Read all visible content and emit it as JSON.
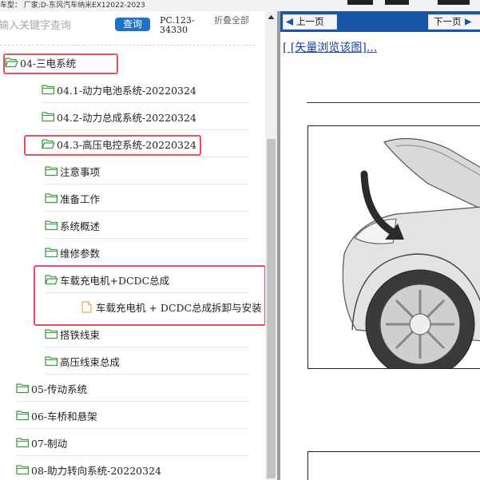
{
  "topbar": {
    "model_text": "车型：  厂家:D-东风汽车纳米EX12022-2023"
  },
  "search": {
    "placeholder": "输入关键字查询",
    "query_label": "查询",
    "code": "PC.123-34330",
    "collapse_label": "折叠全部"
  },
  "tree": {
    "items": [
      {
        "label": "04-三电系统",
        "type": "folder",
        "open": true,
        "highlighted": true
      },
      {
        "label": "04.1-动力电池系统-20220324",
        "type": "folder",
        "open": false
      },
      {
        "label": "04.2-动力总成系统-20220324",
        "type": "folder",
        "open": false
      },
      {
        "label": "04.3-高压电控系统-20220324",
        "type": "folder",
        "open": true,
        "highlighted": true
      },
      {
        "label": "注意事项",
        "type": "folder",
        "open": false
      },
      {
        "label": "准备工作",
        "type": "folder",
        "open": false
      },
      {
        "label": "系统概述",
        "type": "folder",
        "open": false
      },
      {
        "label": "维修参数",
        "type": "folder",
        "open": false
      },
      {
        "label": "车载充电机+DCDC总成",
        "type": "folder",
        "open": true,
        "highlighted": true
      },
      {
        "label": "车载充电机 + DCDC总成拆卸与安装",
        "type": "file",
        "highlighted": true
      },
      {
        "label": "搭铁线束",
        "type": "folder",
        "open": false
      },
      {
        "label": "高压线束总成",
        "type": "folder",
        "open": false
      },
      {
        "label": "05-传动系统",
        "type": "folder",
        "open": false
      },
      {
        "label": "06-车桥和悬架",
        "type": "folder",
        "open": false
      },
      {
        "label": "07-制动",
        "type": "folder",
        "open": false
      },
      {
        "label": "08-助力转向系统-20220324",
        "type": "folder",
        "open": false
      }
    ]
  },
  "viewer": {
    "prev_label": "上一页",
    "next_label": "下一页",
    "vector_link": "[ [矢量浏览该图]..."
  },
  "colors": {
    "nav_blue": "#1a56a6",
    "query_blue": "#1f73c7",
    "highlight_red": "#e5535e",
    "folder_green": "#3f9b3f",
    "file_orange": "#e7a75e"
  }
}
